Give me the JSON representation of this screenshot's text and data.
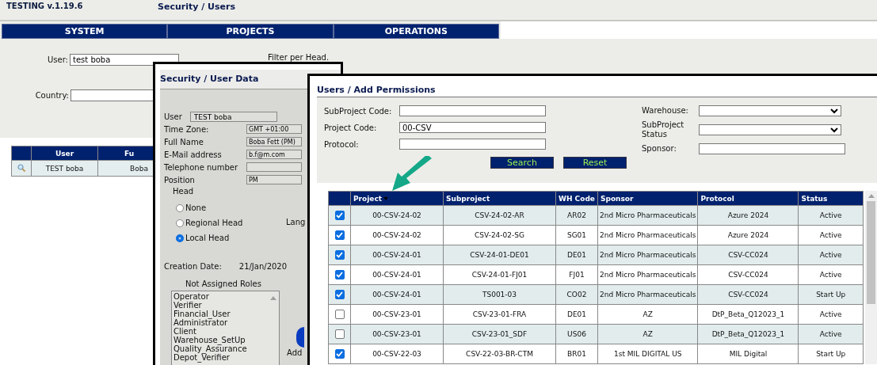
{
  "app": {
    "version": "TESTING v.1.19.6",
    "page_title": "Security / Users"
  },
  "nav": [
    {
      "label": "SYSTEM"
    },
    {
      "label": "PROJECTS"
    },
    {
      "label": "OPERATIONS"
    }
  ],
  "filters": {
    "user": {
      "label": "User:",
      "value": "test boba"
    },
    "filter_per_head": "Filter per Head.",
    "country": {
      "label": "Country:"
    }
  },
  "users_table": {
    "columns": [
      "User",
      "Fu"
    ],
    "rows": [
      {
        "user": "TEST boba",
        "column_3": "Boba"
      }
    ]
  },
  "user_data_window": {
    "title": "Security / User Data",
    "user": {
      "label": "User",
      "value": "TEST boba"
    },
    "fields": [
      {
        "label": "Time Zone:",
        "value": "GMT +01:00"
      },
      {
        "label": "Full Name",
        "value": "Boba Fett (PM)"
      },
      {
        "label": "E-Mail address",
        "value": "b.f@m.com"
      },
      {
        "label": "Telephone number"
      },
      {
        "label": "Position",
        "value": "PM"
      }
    ],
    "head_label": "Head",
    "head_options": [
      {
        "label": "None",
        "selected": false
      },
      {
        "label": "Regional Head",
        "selected": false
      },
      {
        "label": "Local Head",
        "selected": true
      }
    ],
    "language_label": "Lang",
    "creation_date": {
      "label": "Creation Date:",
      "value": "21/Jan/2020"
    },
    "roles_label": "Not Assigned Roles",
    "roles": [
      "Operator",
      "Verifier",
      "Financial_User",
      "Administrator",
      "Client",
      "Warehouse_SetUp",
      "Quality_Assurance",
      "Depot_Verifier"
    ],
    "add_label": "Add"
  },
  "permissions_window": {
    "title": "Users / Add Permissions",
    "left_fields": [
      {
        "label": "SubProject Code:"
      },
      {
        "label": "Project Code:",
        "value": "00-CSV"
      },
      {
        "label": "Protocol:"
      }
    ],
    "right_fields": [
      {
        "kind": "select",
        "label": "Warehouse:"
      },
      {
        "kind": "select",
        "label": "SubProject Status"
      },
      {
        "kind": "text",
        "label": "Sponsor:"
      }
    ],
    "buttons": [
      "Search",
      "Reset"
    ],
    "table": {
      "columns": [
        {
          "label": "Project",
          "sorted": true
        },
        {
          "label": "Subproject",
          "sorted": false
        },
        {
          "label": "WH Code",
          "sorted": false
        },
        {
          "label": "Sponsor",
          "sorted": false
        },
        {
          "label": "Protocol",
          "sorted": false
        },
        {
          "label": "Status",
          "sorted": false
        }
      ],
      "rows": [
        {
          "checked": true,
          "cells": [
            "00-CSV-24-02",
            "CSV-24-02-AR",
            "AR02",
            "2nd Micro Pharmaceuticals",
            "Azure 2024",
            "Active"
          ]
        },
        {
          "checked": true,
          "cells": [
            "00-CSV-24-02",
            "CSV-24-02-SG",
            "SG01",
            "2nd Micro Pharmaceuticals",
            "Azure 2024",
            "Active"
          ]
        },
        {
          "checked": true,
          "cells": [
            "00-CSV-24-01",
            "CSV-24-01-DE01",
            "DE01",
            "2nd Micro Pharmaceuticals",
            "CSV-CC024",
            "Active"
          ]
        },
        {
          "checked": true,
          "cells": [
            "00-CSV-24-01",
            "CSV-24-01-FJ01",
            "FJ01",
            "2nd Micro Pharmaceuticals",
            "CSV-CC024",
            "Active"
          ]
        },
        {
          "checked": true,
          "cells": [
            "00-CSV-24-01",
            "TS001-03",
            "CO02",
            "2nd Micro Pharmaceuticals",
            "CSV-CC024",
            "Start Up"
          ]
        },
        {
          "checked": false,
          "cells": [
            "00-CSV-23-01",
            "CSV-23-01-FRA",
            "DE01",
            "AZ",
            "DtP_Beta_Q12023_1",
            "Active"
          ]
        },
        {
          "checked": false,
          "cells": [
            "00-CSV-23-01",
            "CSV-23-01_SDF",
            "US06",
            "AZ",
            "DtP_Beta_Q12023_1",
            "Active"
          ]
        },
        {
          "checked": true,
          "cells": [
            "00-CSV-22-03",
            "CSV-22-03-BR-CTM",
            "BR01",
            "1st MIL DIGITAL US",
            "MIL Digital",
            "Start Up"
          ]
        }
      ]
    }
  }
}
